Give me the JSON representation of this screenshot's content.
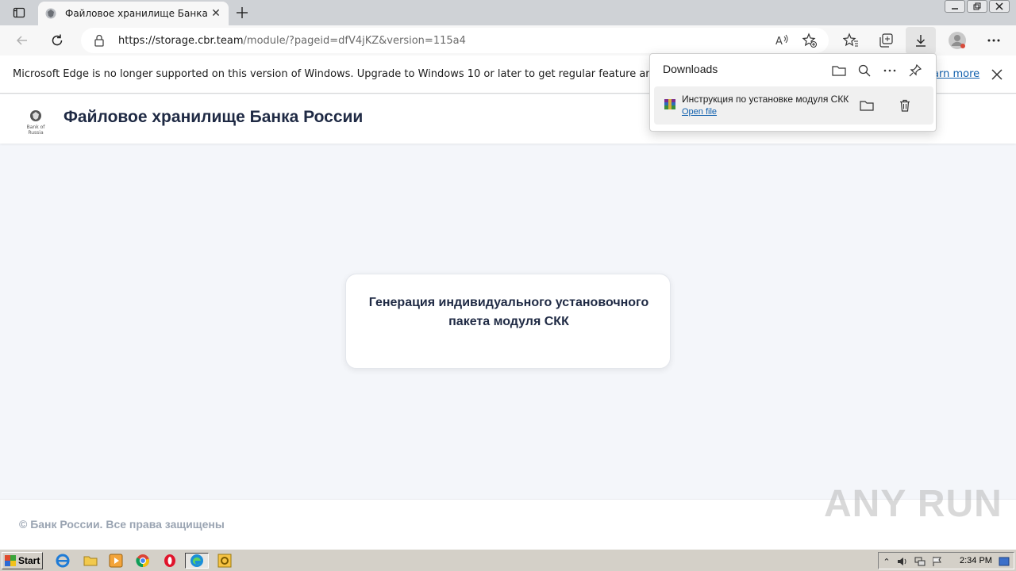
{
  "browser": {
    "tab_title": "Файловое хранилище Банка Ро",
    "url_host": "https://storage.cbr.team",
    "url_path": "/module/?pageid=dfV4jKZ&version=115a4"
  },
  "infobar": {
    "message": "Microsoft Edge is no longer supported on this version of Windows. Upgrade to Windows 10 or later to get regular feature and security u",
    "link": "arn more"
  },
  "site": {
    "logo_caption": "Bank of Russia",
    "title": "Файловое хранилище Банка России",
    "card_text": "Генерация индивидуального установочного пакета модуля СКК",
    "footer": "© Банк России. Все права защищены"
  },
  "downloads": {
    "title": "Downloads",
    "item_name": "Инструкция по установке модуля СКК",
    "item_action": "Open file"
  },
  "taskbar": {
    "start_label": "Start",
    "clock": "2:34 PM"
  },
  "watermark": "ANY RUN",
  "colors": {
    "page_bg": "#f4f6fa",
    "title_text": "#1f2a44",
    "link": "#0f5fad",
    "footer_text": "#9aa4b2"
  }
}
